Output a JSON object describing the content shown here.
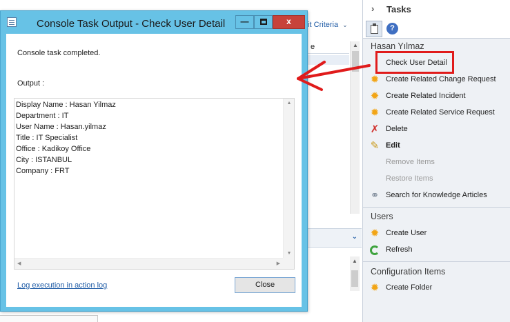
{
  "background": {
    "criteria_link": "dit Criteria",
    "column_fragment": "e"
  },
  "task_pane": {
    "header_title": "Tasks",
    "help_label": "?",
    "sections": {
      "item_title": "Hasan Yılmaz",
      "users_title": "Users",
      "config_title": "Configuration Items"
    },
    "items": [
      {
        "label": "Check User Detail",
        "icon": "none"
      },
      {
        "label": "Create Related Change Request",
        "icon": "sun-icon"
      },
      {
        "label": "Create Related Incident",
        "icon": "sun-icon"
      },
      {
        "label": "Create Related Service Request",
        "icon": "sun-icon"
      },
      {
        "label": "Delete",
        "icon": "delete-x-icon"
      },
      {
        "label": "Edit",
        "icon": "pencil-icon"
      },
      {
        "label": "Remove Items",
        "icon": "none",
        "disabled": true
      },
      {
        "label": "Restore Items",
        "icon": "none",
        "disabled": true
      },
      {
        "label": "Search for Knowledge Articles",
        "icon": "link-icon"
      }
    ],
    "user_items": [
      {
        "label": "Create User",
        "icon": "sun-icon"
      },
      {
        "label": "Refresh",
        "icon": "refresh-icon"
      }
    ],
    "config_items": [
      {
        "label": "Create Folder",
        "icon": "folder-new-icon"
      }
    ],
    "highlight_color": "#e01b1b"
  },
  "dialog": {
    "title": "Console Task Output - Check User Detail",
    "minimize_glyph": "—",
    "close_glyph": "x",
    "completed_message": "Console task completed.",
    "output_label": "Output :",
    "output_lines": [
      "Display Name :  Hasan Yilmaz",
      "Department :  IT",
      "User Name :  Hasan.yilmaz",
      "Title :  IT Specialist",
      "Office :  Kadikoy Office",
      "City :  ISTANBUL",
      "Company :  FRT"
    ],
    "log_link": "Log execution in action log",
    "close_button": "Close",
    "title_bar_color": "#67c2e6",
    "close_button_color": "#c7423a"
  },
  "annotation": {
    "arrow_color": "#e01b1b"
  }
}
